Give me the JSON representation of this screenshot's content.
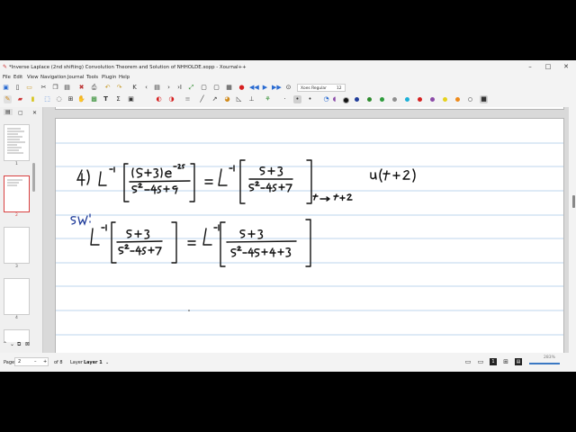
{
  "window": {
    "title": "*Inverse Laplace (2nd shifting) Convolution Theorem and Solution of NHHOLDE.xopp - Xournal++",
    "minimize": "–",
    "maximize": "□",
    "close": "✕"
  },
  "menu": [
    "File",
    "Edit",
    "View",
    "Navigation",
    "Journal",
    "Tools",
    "Plugin",
    "Help"
  ],
  "toolbar": {
    "zoom_label": "Xoes Regular",
    "zoom_value": "12"
  },
  "colors": {
    "palette": [
      "#111111",
      "#1f3c9a",
      "#2d8b2d",
      "#2d9c3c",
      "#8f8f8f",
      "#1bb0d8",
      "#d62020",
      "#8b4aa8",
      "#e6d21b",
      "#ee8a1a",
      "#ffffff",
      "#111111"
    ]
  },
  "sidebar": {
    "pages": [
      "1",
      "2",
      "3",
      "4"
    ],
    "selected_page": "2",
    "close": "✕"
  },
  "status": {
    "page_label": "Page",
    "page_value": "2",
    "page_of": "of 8",
    "layer_label": "Layer",
    "layer_value": "Layer 1",
    "zoom_percent": "283%"
  },
  "page_content": {
    "problem_number": "4)",
    "sw_label": "SW:"
  }
}
